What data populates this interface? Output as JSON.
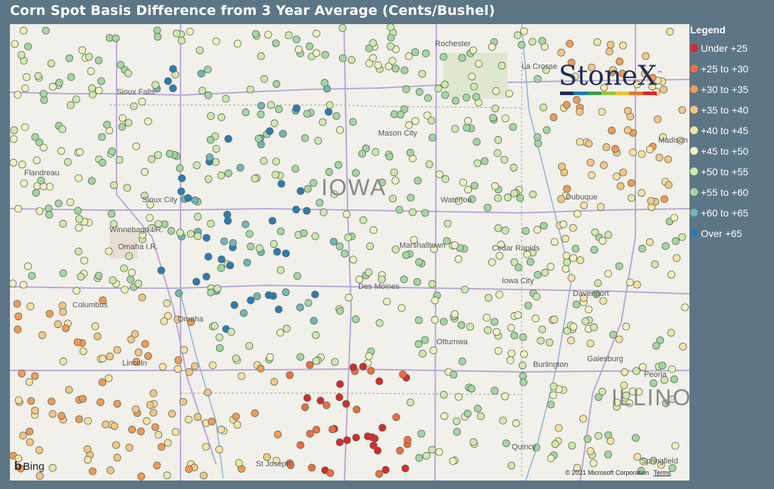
{
  "title": "Corn Spot Basis Difference from 3 Year Average (Cents/Bushel)",
  "legend": {
    "title": "Legend",
    "items": [
      {
        "label": "Under +25",
        "color": "#d9292b"
      },
      {
        "label": "+25 to +30",
        "color": "#ec6e3f"
      },
      {
        "label": "+30 to +35",
        "color": "#f29a56"
      },
      {
        "label": "+35 to +40",
        "color": "#f6c583"
      },
      {
        "label": "+40 to +45",
        "color": "#f8e3a3"
      },
      {
        "label": "+45 to +50",
        "color": "#f1f2bf"
      },
      {
        "label": "+50 to +55",
        "color": "#cfe9ac"
      },
      {
        "label": "+55 to +60",
        "color": "#a3d7a1"
      },
      {
        "label": "+60 to +65",
        "color": "#6fb6b6"
      },
      {
        "label": "Over +65",
        "color": "#2c7bb6"
      }
    ]
  },
  "logo": {
    "text": "StoneX",
    "tm": "™",
    "bar_colors": [
      "#1f2d54",
      "#1f7ab8",
      "#3a9a4d",
      "#9bc53d",
      "#f1c232",
      "#e8772e",
      "#d9292b"
    ]
  },
  "map": {
    "state_label": "IOWA",
    "state_label_2": "ILLINO",
    "cities": [
      "Rochester",
      "La Crosse",
      "Sioux Falls",
      "Mason City",
      "Madison",
      "Sioux City",
      "Waterloo",
      "Dubuque",
      "Winnebago I.R.",
      "Omaha I.R.",
      "Marshalltown",
      "Cedar Rapids",
      "Des Moines",
      "Iowa City",
      "Davenport",
      "Columbus",
      "Omaha",
      "Lincoln",
      "Ottumwa",
      "Burlington",
      "Galesburg",
      "Peoria",
      "Quincy",
      "St Joseph",
      "Springfield",
      "Flandreau"
    ],
    "attribution": {
      "bing": "Bing",
      "copyright": "© 2021 Microsoft Corporation",
      "terms": "Terms"
    }
  }
}
